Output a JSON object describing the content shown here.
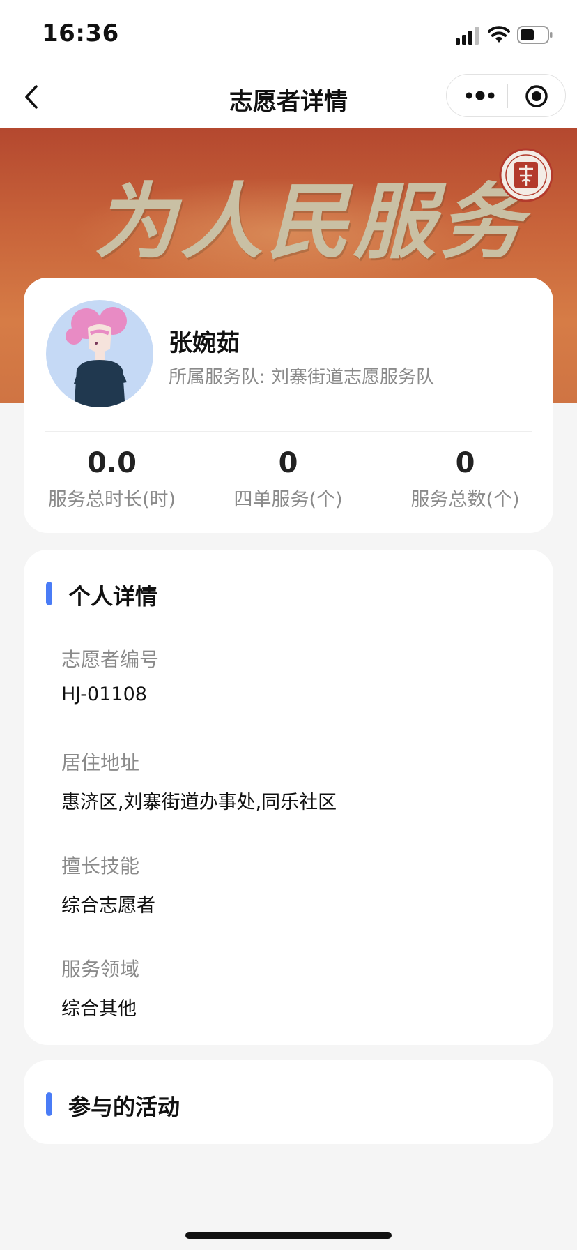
{
  "status_bar": {
    "time": "16:36",
    "signal_icon": "cellular-signal-icon",
    "wifi_icon": "wifi-icon",
    "battery_icon": "battery-icon"
  },
  "nav": {
    "title": "志愿者详情",
    "back_icon": "chevron-left-icon",
    "more_icon": "more-dots-icon",
    "close_icon": "target-circle-icon"
  },
  "banner": {
    "slogan": "为人民服务",
    "seal_icon": "volunteer-seal-icon"
  },
  "profile": {
    "name": "张婉茹",
    "team_label": "所属服务队:",
    "team": "刘寨街道志愿服务队",
    "stats": [
      {
        "value": "0.0",
        "label": "服务总时长(时)"
      },
      {
        "value": "0",
        "label": "四单服务(个)"
      },
      {
        "value": "0",
        "label": "服务总数(个)"
      }
    ]
  },
  "details": {
    "title": "个人详情",
    "fields": [
      {
        "label": "志愿者编号",
        "value": "HJ-01108"
      },
      {
        "label": "居住地址",
        "value": "惠济区,刘寨街道办事处,同乐社区"
      },
      {
        "label": "擅长技能",
        "value": "综合志愿者"
      },
      {
        "label": "服务领域",
        "value": "综合其他"
      }
    ]
  },
  "activities": {
    "title": "参与的活动"
  },
  "colors": {
    "accent": "#4a7cf6",
    "banner": "#c8633a",
    "muted_text": "#8a8a8a"
  }
}
